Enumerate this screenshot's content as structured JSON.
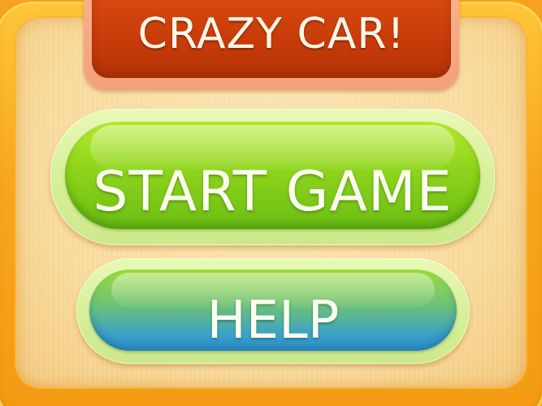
{
  "menu": {
    "title": "CRAZY CAR!",
    "buttons": {
      "start_label": "START GAME",
      "help_label": "HELP"
    }
  },
  "colors": {
    "frame": "#f7a51d",
    "panel": "#f8d99a",
    "title_banner": "#c93d0a",
    "start_button": "#8ed41c",
    "help_button_top": "#9fdc3c",
    "help_button_bottom": "#2f95d2",
    "label_text": "#fbffef"
  }
}
